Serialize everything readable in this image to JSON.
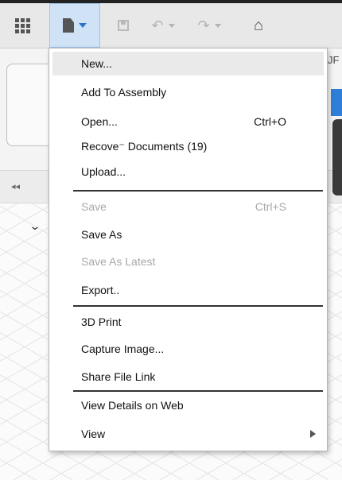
{
  "toolbar": {
    "icons": [
      "grid-icon",
      "file-icon",
      "save-icon",
      "undo-icon",
      "redo-icon",
      "home-icon"
    ],
    "accent": "#cfe2f6"
  },
  "workspace": {
    "right_edge_text": "JF"
  },
  "menu": {
    "new": "New...",
    "add_to_assembly": "Add To Assembly",
    "open": "Open...",
    "open_shortcut": "Ctrl+O",
    "recover": "Recove⁻ Documents (19)",
    "upload": "Upload...",
    "save": "Save",
    "save_shortcut": "Ctrl+S",
    "save_as": "Save As",
    "save_as_latest": "Save As Latest",
    "export": "Export..",
    "print_3d": "3D Print",
    "capture_image": "Capture Image...",
    "share_file_link": "Share File Link",
    "view_details": "View Details on Web",
    "view": "View"
  }
}
